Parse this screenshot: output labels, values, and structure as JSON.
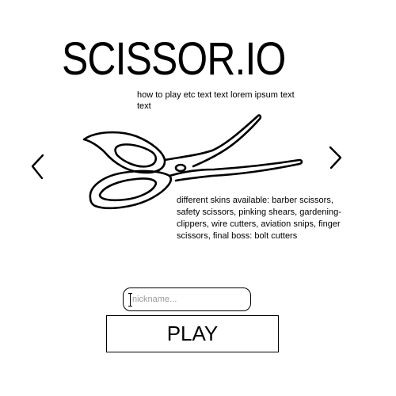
{
  "header": {
    "title": "SCISSOR.IO",
    "how_to_play": "how to play etc text text lorem ipsum text text"
  },
  "carousel": {
    "prev_icon": "chevron-left-icon",
    "next_icon": "chevron-right-icon",
    "preview_icon": "scissors-icon",
    "skins_text": "different skins available: barber scissors, safety scissors, pinking shears, gardening-clippers, wire cutters, aviation snips, finger scissors, final boss: bolt cutters"
  },
  "form": {
    "nickname_placeholder": "nickname...",
    "nickname_value": "",
    "play_label": "PLAY"
  }
}
